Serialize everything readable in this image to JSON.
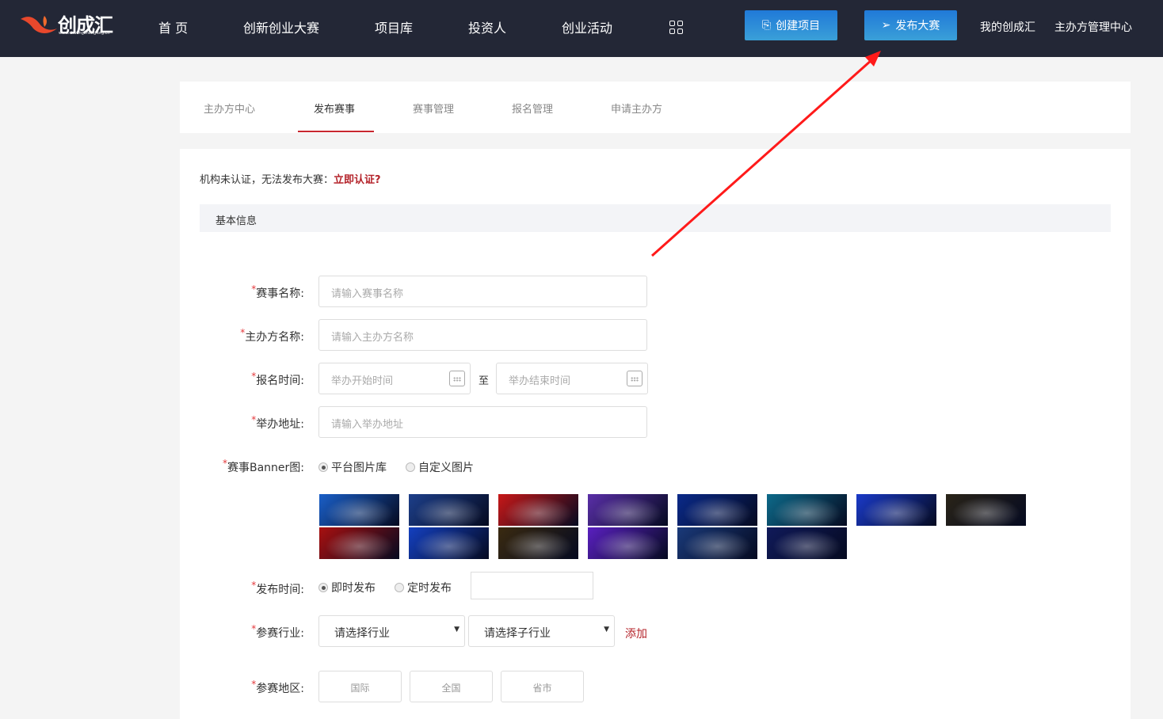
{
  "header": {
    "logo": {
      "name": "创成汇",
      "url": "www.chuangcheng.org.cn"
    },
    "nav": [
      "首 页",
      "创新创业大赛",
      "项目库",
      "投资人",
      "创业活动"
    ],
    "apps_icon": "grid-icon",
    "create_project": "创建项目",
    "publish_contest": "发布大赛",
    "my_link": "我的创成汇",
    "organizer_center": "主办方管理中心"
  },
  "tabs": [
    "主办方中心",
    "发布赛事",
    "赛事管理",
    "报名管理",
    "申请主办方"
  ],
  "active_tab": "发布赛事",
  "notice": {
    "text": "机构未认证，无法发布大赛：",
    "link": "立即认证?"
  },
  "section_title": "基本信息",
  "form": {
    "required_mark": "*",
    "name": {
      "label": "赛事名称:",
      "placeholder": "请输入赛事名称"
    },
    "organizer": {
      "label": "主办方名称:",
      "placeholder": "请输入主办方名称"
    },
    "signup_time": {
      "label": "报名时间:",
      "start_placeholder": "举办开始时间",
      "separator": "至",
      "end_placeholder": "举办结束时间"
    },
    "address": {
      "label": "举办地址:",
      "placeholder": "请输入举办地址"
    },
    "banner": {
      "label": "赛事Banner图:",
      "options": [
        "平台图片库",
        "自定义图片"
      ],
      "selected": "平台图片库",
      "thumbnails": [
        "#1a5fc8",
        "#1d3f8a",
        "#c81818",
        "#5a2fa8",
        "#0a2a8a",
        "#0d6a8a",
        "#1a3ac8",
        "#2a2418",
        "#a81010",
        "#1440c0",
        "#3a2a10",
        "#5a20c0",
        "#1a3a7a",
        "#101a5a"
      ]
    },
    "publish_time": {
      "label": "发布时间:",
      "options": [
        "即时发布",
        "定时发布"
      ],
      "selected": "即时发布",
      "value": ""
    },
    "industry": {
      "label": "参赛行业:",
      "select1": "请选择行业",
      "select2": "请选择子行业",
      "add": "添加"
    },
    "region": {
      "label": "参赛地区:",
      "options": [
        "国际",
        "全国",
        "省市"
      ]
    }
  },
  "annotation_color": "#ff1a1a"
}
